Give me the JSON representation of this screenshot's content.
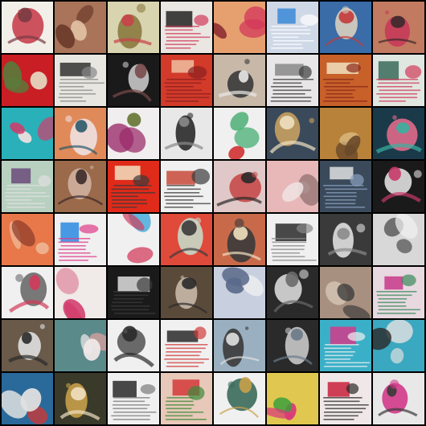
{
  "grid": {
    "rows": 8,
    "cols": 8,
    "border_color": "#000000",
    "tiles": [
      {
        "bg": "#f2efe9",
        "fg": "#c8404f",
        "ac": "#7a3b43",
        "kind": "figure"
      },
      {
        "bg": "#a9745a",
        "fg": "#6b3a2a",
        "ac": "#e6c6a8",
        "kind": "blob"
      },
      {
        "bg": "#d9d4b0",
        "fg": "#8a7a40",
        "ac": "#c9424a",
        "kind": "figure"
      },
      {
        "bg": "#eae6e2",
        "fg": "#222222",
        "ac": "#d23a5a",
        "kind": "text"
      },
      {
        "bg": "#e6a070",
        "fg": "#d43a5a",
        "ac": "#8a2a30",
        "kind": "blob"
      },
      {
        "bg": "#cfd8e6",
        "fg": "#3a8ad6",
        "ac": "#ffffff",
        "kind": "text"
      },
      {
        "bg": "#3a6ca8",
        "fg": "#d9d0c0",
        "ac": "#c23a3a",
        "kind": "figure"
      },
      {
        "bg": "#c27a60",
        "fg": "#c83a5a",
        "ac": "#3a2a2a",
        "kind": "figure"
      },
      {
        "bg": "#c81e24",
        "fg": "#5a7a3a",
        "ac": "#e6e0c8",
        "kind": "blob"
      },
      {
        "bg": "#e8e6e0",
        "fg": "#333333",
        "ac": "#888888",
        "kind": "text"
      },
      {
        "bg": "#1a1a1a",
        "fg": "#c8c8c8",
        "ac": "#7a4a4a",
        "kind": "figure"
      },
      {
        "bg": "#d23a2a",
        "fg": "#f0c0a0",
        "ac": "#8a2020",
        "kind": "text"
      },
      {
        "bg": "#c8b8a8",
        "fg": "#3a3a3a",
        "ac": "#e8e8e8",
        "kind": "figure"
      },
      {
        "bg": "#e8e6e6",
        "fg": "#888888",
        "ac": "#3a3a3a",
        "kind": "text"
      },
      {
        "bg": "#c8602a",
        "fg": "#f0e0c0",
        "ac": "#8a2a1a",
        "kind": "text"
      },
      {
        "bg": "#e0e6e0",
        "fg": "#3a6a5a",
        "ac": "#d23a5a",
        "kind": "text"
      },
      {
        "bg": "#2ab0b8",
        "fg": "#d23a6a",
        "ac": "#f0e0e0",
        "kind": "blob"
      },
      {
        "bg": "#e08a5a",
        "fg": "#f0e0e0",
        "ac": "#2a5a6a",
        "kind": "figure"
      },
      {
        "bg": "#f0eeee",
        "fg": "#9a2a6a",
        "ac": "#6a7a3a",
        "kind": "blob"
      },
      {
        "bg": "#e8e8e8",
        "fg": "#2a2a2a",
        "ac": "#8a8a8a",
        "kind": "figure"
      },
      {
        "bg": "#f0f0f0",
        "fg": "#3aa86a",
        "ac": "#d23a3a",
        "kind": "blob"
      },
      {
        "bg": "#3a4a5a",
        "fg": "#c8a060",
        "ac": "#f0e0c0",
        "kind": "figure"
      },
      {
        "bg": "#b8823a",
        "fg": "#6a4a2a",
        "ac": "#e0c890",
        "kind": "blob"
      },
      {
        "bg": "#1a3a4a",
        "fg": "#e06a8a",
        "ac": "#3ab0a0",
        "kind": "figure"
      },
      {
        "bg": "#b8d0c0",
        "fg": "#6a4a7a",
        "ac": "#e0e0e0",
        "kind": "text"
      },
      {
        "bg": "#9a6a4a",
        "fg": "#d0b0a0",
        "ac": "#3a2a2a",
        "kind": "figure"
      },
      {
        "bg": "#e02a1a",
        "fg": "#f0e0c0",
        "ac": "#3a3a3a",
        "kind": "text"
      },
      {
        "bg": "#f0f0f0",
        "fg": "#c84a3a",
        "ac": "#3a3a3a",
        "kind": "text"
      },
      {
        "bg": "#e0c8c8",
        "fg": "#c84a4a",
        "ac": "#2a2a2a",
        "kind": "figure"
      },
      {
        "bg": "#e8b8b8",
        "fg": "#f0e0e0",
        "ac": "#8a6a6a",
        "kind": "blob"
      },
      {
        "bg": "#3a4a5a",
        "fg": "#e0e0e0",
        "ac": "#8aa0c0",
        "kind": "text"
      },
      {
        "bg": "#1a1a1a",
        "fg": "#e0e0e0",
        "ac": "#c83a6a",
        "kind": "figure"
      },
      {
        "bg": "#e8784a",
        "fg": "#f0c0a0",
        "ac": "#8a3a2a",
        "kind": "blob"
      },
      {
        "bg": "#f0f0f0",
        "fg": "#2a8ae0",
        "ac": "#e03a8a",
        "kind": "text"
      },
      {
        "bg": "#f0f0f0",
        "fg": "#d23a5a",
        "ac": "#2aa0d8",
        "kind": "blob"
      },
      {
        "bg": "#e04a3a",
        "fg": "#c8d8c8",
        "ac": "#3a3a3a",
        "kind": "figure"
      },
      {
        "bg": "#c86a4a",
        "fg": "#3a3a3a",
        "ac": "#f0e0c0",
        "kind": "figure"
      },
      {
        "bg": "#f0f0f0",
        "fg": "#2a2a2a",
        "ac": "#888888",
        "kind": "text"
      },
      {
        "bg": "#3a3a3a",
        "fg": "#e0e0e0",
        "ac": "#8a8a8a",
        "kind": "figure"
      },
      {
        "bg": "#d8d8d8",
        "fg": "#5a5a5a",
        "ac": "#f0f0f0",
        "kind": "blob"
      },
      {
        "bg": "#f0f0f0",
        "fg": "#6a6a6a",
        "ac": "#d23a5a",
        "kind": "figure"
      },
      {
        "bg": "#f0eae8",
        "fg": "#d23a6a",
        "ac": "#e08aa0",
        "kind": "blob"
      },
      {
        "bg": "#1a1a1a",
        "fg": "#e0e0e0",
        "ac": "#3a3a3a",
        "kind": "text"
      },
      {
        "bg": "#5a4a3a",
        "fg": "#c8b8a8",
        "ac": "#2a2a2a",
        "kind": "figure"
      },
      {
        "bg": "#c8d0e0",
        "fg": "#5a6a8a",
        "ac": "#f0f0f0",
        "kind": "blob"
      },
      {
        "bg": "#2a2a2a",
        "fg": "#d8d8d8",
        "ac": "#6a6a6a",
        "kind": "figure"
      },
      {
        "bg": "#a89080",
        "fg": "#3a3a3a",
        "ac": "#d8c8b8",
        "kind": "blob"
      },
      {
        "bg": "#e8d8e0",
        "fg": "#c83a8a",
        "ac": "#3a8a5a",
        "kind": "text"
      },
      {
        "bg": "#6a5a4a",
        "fg": "#e0e0e0",
        "ac": "#2a2a2a",
        "kind": "figure"
      },
      {
        "bg": "#5a8a8a",
        "fg": "#f0e8e8",
        "ac": "#d8a0a0",
        "kind": "blob"
      },
      {
        "bg": "#f0f0f0",
        "fg": "#5a5a5a",
        "ac": "#2a2a2a",
        "kind": "figure"
      },
      {
        "bg": "#f0f0f0",
        "fg": "#2a2a2a",
        "ac": "#d23a3a",
        "kind": "text"
      },
      {
        "bg": "#9ab0c0",
        "fg": "#3a3a3a",
        "ac": "#e0e0e0",
        "kind": "figure"
      },
      {
        "bg": "#2a2a2a",
        "fg": "#c8c8c8",
        "ac": "#6a7a8a",
        "kind": "figure"
      },
      {
        "bg": "#3ab0c8",
        "fg": "#d23a8a",
        "ac": "#f0f0f0",
        "kind": "text"
      },
      {
        "bg": "#3aa8c0",
        "fg": "#e0e0e0",
        "ac": "#2a2a2a",
        "kind": "blob"
      },
      {
        "bg": "#2a6a9a",
        "fg": "#e0e0e0",
        "ac": "#c83a3a",
        "kind": "blob"
      },
      {
        "bg": "#3a3a2a",
        "fg": "#c8a04a",
        "ac": "#f0e0c0",
        "kind": "figure"
      },
      {
        "bg": "#f0f0f0",
        "fg": "#2a2a2a",
        "ac": "#7a7a7a",
        "kind": "text"
      },
      {
        "bg": "#e8c8b8",
        "fg": "#d23a3a",
        "ac": "#3a8a3a",
        "kind": "text"
      },
      {
        "bg": "#f0f0f0",
        "fg": "#3a6a5a",
        "ac": "#c8a04a",
        "kind": "figure"
      },
      {
        "bg": "#e0c850",
        "fg": "#d83a7a",
        "ac": "#3aa03a",
        "kind": "blob"
      },
      {
        "bg": "#f0e8e8",
        "fg": "#c8203a",
        "ac": "#2a2a2a",
        "kind": "text"
      },
      {
        "bg": "#e8e8e8",
        "fg": "#d23a8a",
        "ac": "#3a3a3a",
        "kind": "figure"
      }
    ]
  }
}
